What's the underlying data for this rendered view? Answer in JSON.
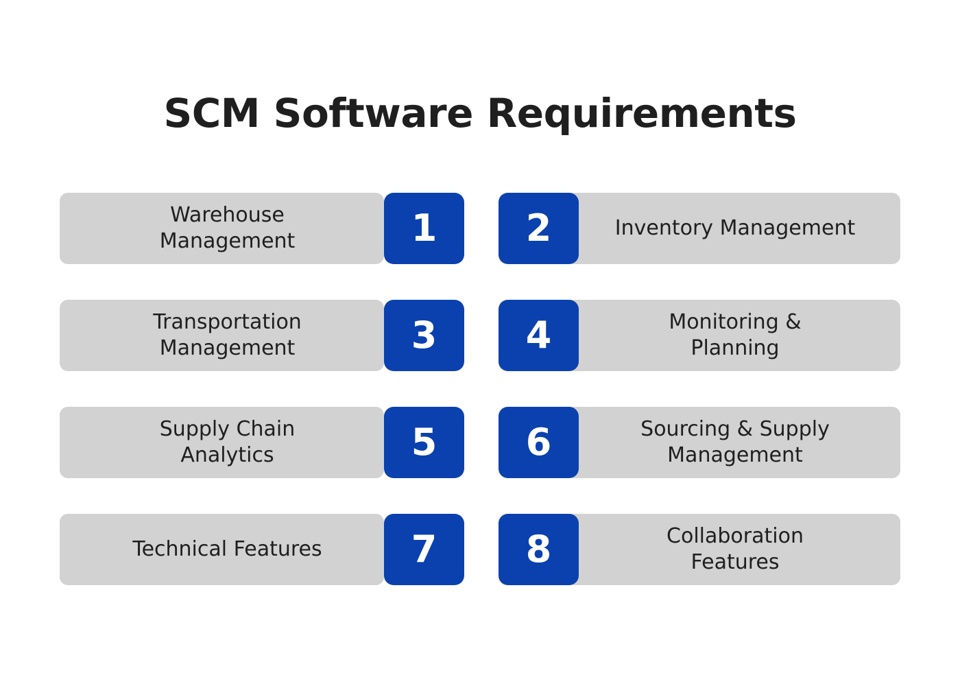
{
  "header": {
    "title": "SCM Software Requirements"
  },
  "theme": {
    "background": "#ffffff",
    "bar_color": "#d2d2d2",
    "badge_color": "#0a41ae",
    "badge_text_color": "#ffffff",
    "text_color": "#1f1f1f"
  },
  "chart_data": {
    "type": "table",
    "title": "SCM Software Requirements",
    "columns": [
      "number",
      "label"
    ],
    "layout": "2-column numbered list, 4 rows; odd numbers in left column with badge on the right side of the bar, even numbers in right column with badge on the left side of the bar",
    "rows": [
      {
        "number": "1",
        "label": "Warehouse Management",
        "column": "left"
      },
      {
        "number": "2",
        "label": "Inventory Management",
        "column": "right"
      },
      {
        "number": "3",
        "label": "Transportation Management",
        "column": "left"
      },
      {
        "number": "4",
        "label": "Monitoring & Planning",
        "column": "right"
      },
      {
        "number": "5",
        "label": "Supply Chain Analytics",
        "column": "left"
      },
      {
        "number": "6",
        "label": "Sourcing & Supply Management",
        "column": "right"
      },
      {
        "number": "7",
        "label": "Technical Features",
        "column": "left"
      },
      {
        "number": "8",
        "label": "Collaboration Features",
        "column": "right"
      }
    ]
  },
  "items": [
    {
      "number": "1",
      "label": "Warehouse\nManagement"
    },
    {
      "number": "2",
      "label": "Inventory Management"
    },
    {
      "number": "3",
      "label": "Transportation\nManagement"
    },
    {
      "number": "4",
      "label": "Monitoring &\nPlanning"
    },
    {
      "number": "5",
      "label": "Supply Chain\nAnalytics"
    },
    {
      "number": "6",
      "label": "Sourcing & Supply\nManagement"
    },
    {
      "number": "7",
      "label": "Technical Features"
    },
    {
      "number": "8",
      "label": "Collaboration\nFeatures"
    }
  ]
}
